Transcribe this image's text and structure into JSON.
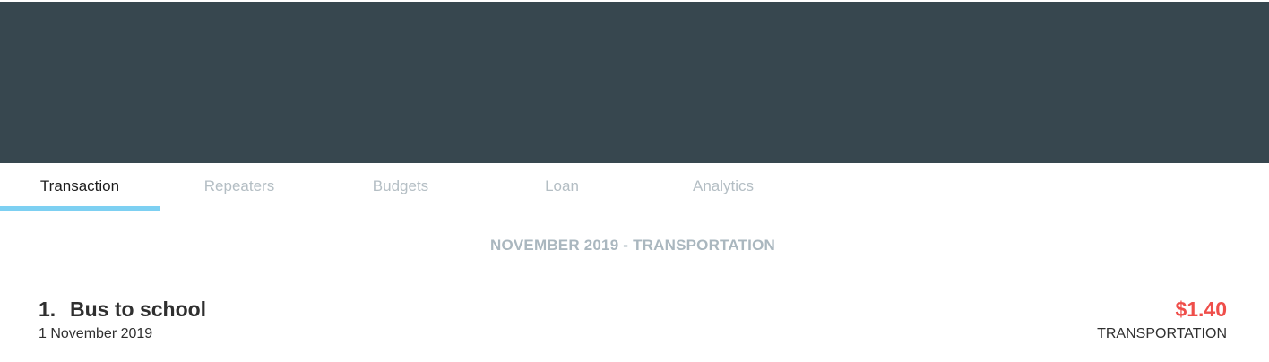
{
  "tabs": [
    {
      "label": "Transaction",
      "active": true
    },
    {
      "label": "Repeaters",
      "active": false
    },
    {
      "label": "Budgets",
      "active": false
    },
    {
      "label": "Loan",
      "active": false
    },
    {
      "label": "Analytics",
      "active": false
    }
  ],
  "colors": {
    "header_bg": "#37474f",
    "tab_indicator": "#7dd0f2",
    "amount_expense": "#ef4e4a",
    "heading_muted": "#aab7bf"
  },
  "section": {
    "heading": "NOVEMBER 2019 - TRANSPORTATION"
  },
  "transactions": [
    {
      "index": "1.",
      "title": "Bus to school",
      "date": "1 November 2019",
      "amount": "$1.40",
      "category": "TRANSPORTATION"
    }
  ]
}
